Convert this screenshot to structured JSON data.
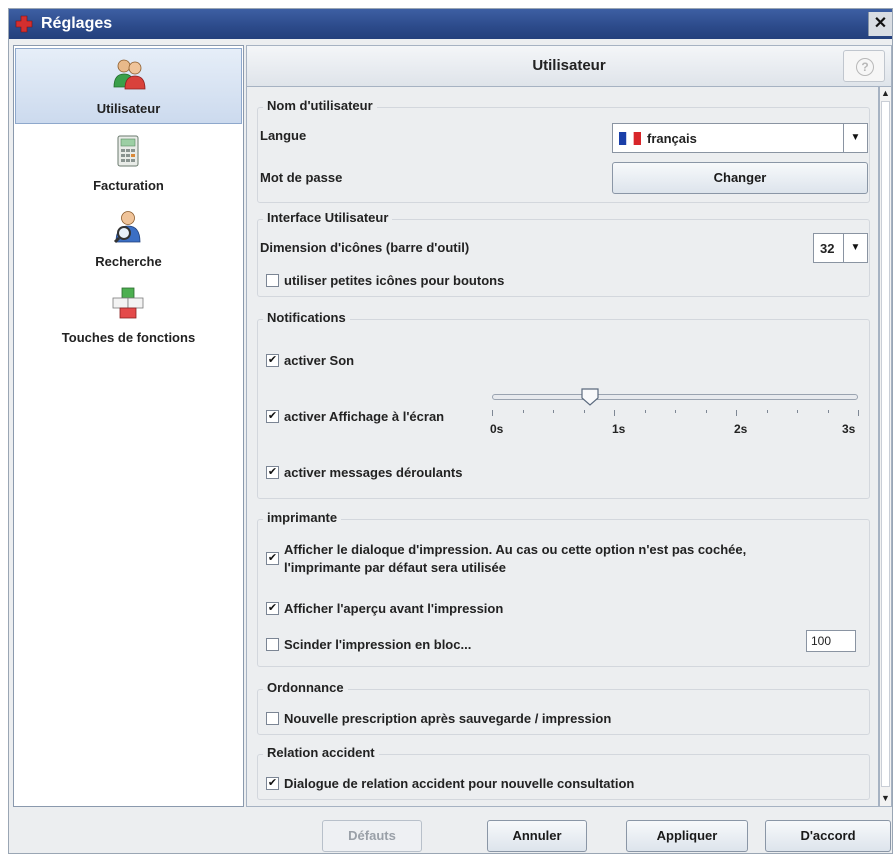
{
  "window": {
    "title": "Réglages",
    "close_glyph": "✕",
    "app_icon": "red-cross-icon"
  },
  "sidebar": {
    "items": [
      {
        "label": "Utilisateur",
        "icon": "users-icon",
        "selected": true
      },
      {
        "label": "Facturation",
        "icon": "calculator-icon",
        "selected": false
      },
      {
        "label": "Recherche",
        "icon": "search-person-icon",
        "selected": false
      },
      {
        "label": "Touches de fonctions",
        "icon": "keyboard-keys-icon",
        "selected": false
      }
    ]
  },
  "header": {
    "title": "Utilisateur",
    "help_glyph": "?"
  },
  "sections": {
    "username": {
      "title": "Nom d'utilisateur",
      "language_label": "Langue",
      "language_value": "français",
      "password_label": "Mot de passe",
      "change_button": "Changer"
    },
    "ui": {
      "title": "Interface Utilisateur",
      "icon_size_label": "Dimension d'icônes (barre d'outil)",
      "icon_size_value": "32",
      "small_icons_label": "utiliser petites icônes pour boutons",
      "small_icons_checked": false
    },
    "notifications": {
      "title": "Notifications",
      "sound_label": "activer Son",
      "sound_checked": true,
      "display_label": "activer Affichage à l'écran",
      "display_checked": true,
      "slider_ticks": [
        "0s",
        "1s",
        "2s",
        "3s"
      ],
      "slider_value_s": 0.8,
      "slider_max_s": 3,
      "scroll_label": "activer messages déroulants",
      "scroll_checked": true
    },
    "printer": {
      "title": "imprimante",
      "dialog_label_line1": "Afficher le dialoque d'impression. Au cas ou cette option n'est pas cochée,",
      "dialog_label_line2": "l'imprimante par défaut sera utilisée",
      "dialog_checked": true,
      "preview_label": "Afficher l'aperçu avant l'impression",
      "preview_checked": true,
      "split_label": "Scinder l'impression en bloc...",
      "split_checked": false,
      "split_value": "100"
    },
    "prescription": {
      "title": "Ordonnance",
      "new_label": "Nouvelle prescription après sauvegarde / impression",
      "new_checked": false
    },
    "accident": {
      "title": "Relation accident",
      "dialog_label": "Dialogue de relation accident pour nouvelle consultation",
      "dialog_checked": true
    }
  },
  "footer": {
    "defaults": "Défauts",
    "cancel": "Annuler",
    "apply": "Appliquer",
    "ok": "D'accord"
  },
  "check_glyph": "✔",
  "dropdown_glyph": "▼",
  "colors": {
    "titlebar": "#2c4a8a",
    "selection": "#ccdaee",
    "accent_red": "#d32f2f"
  }
}
